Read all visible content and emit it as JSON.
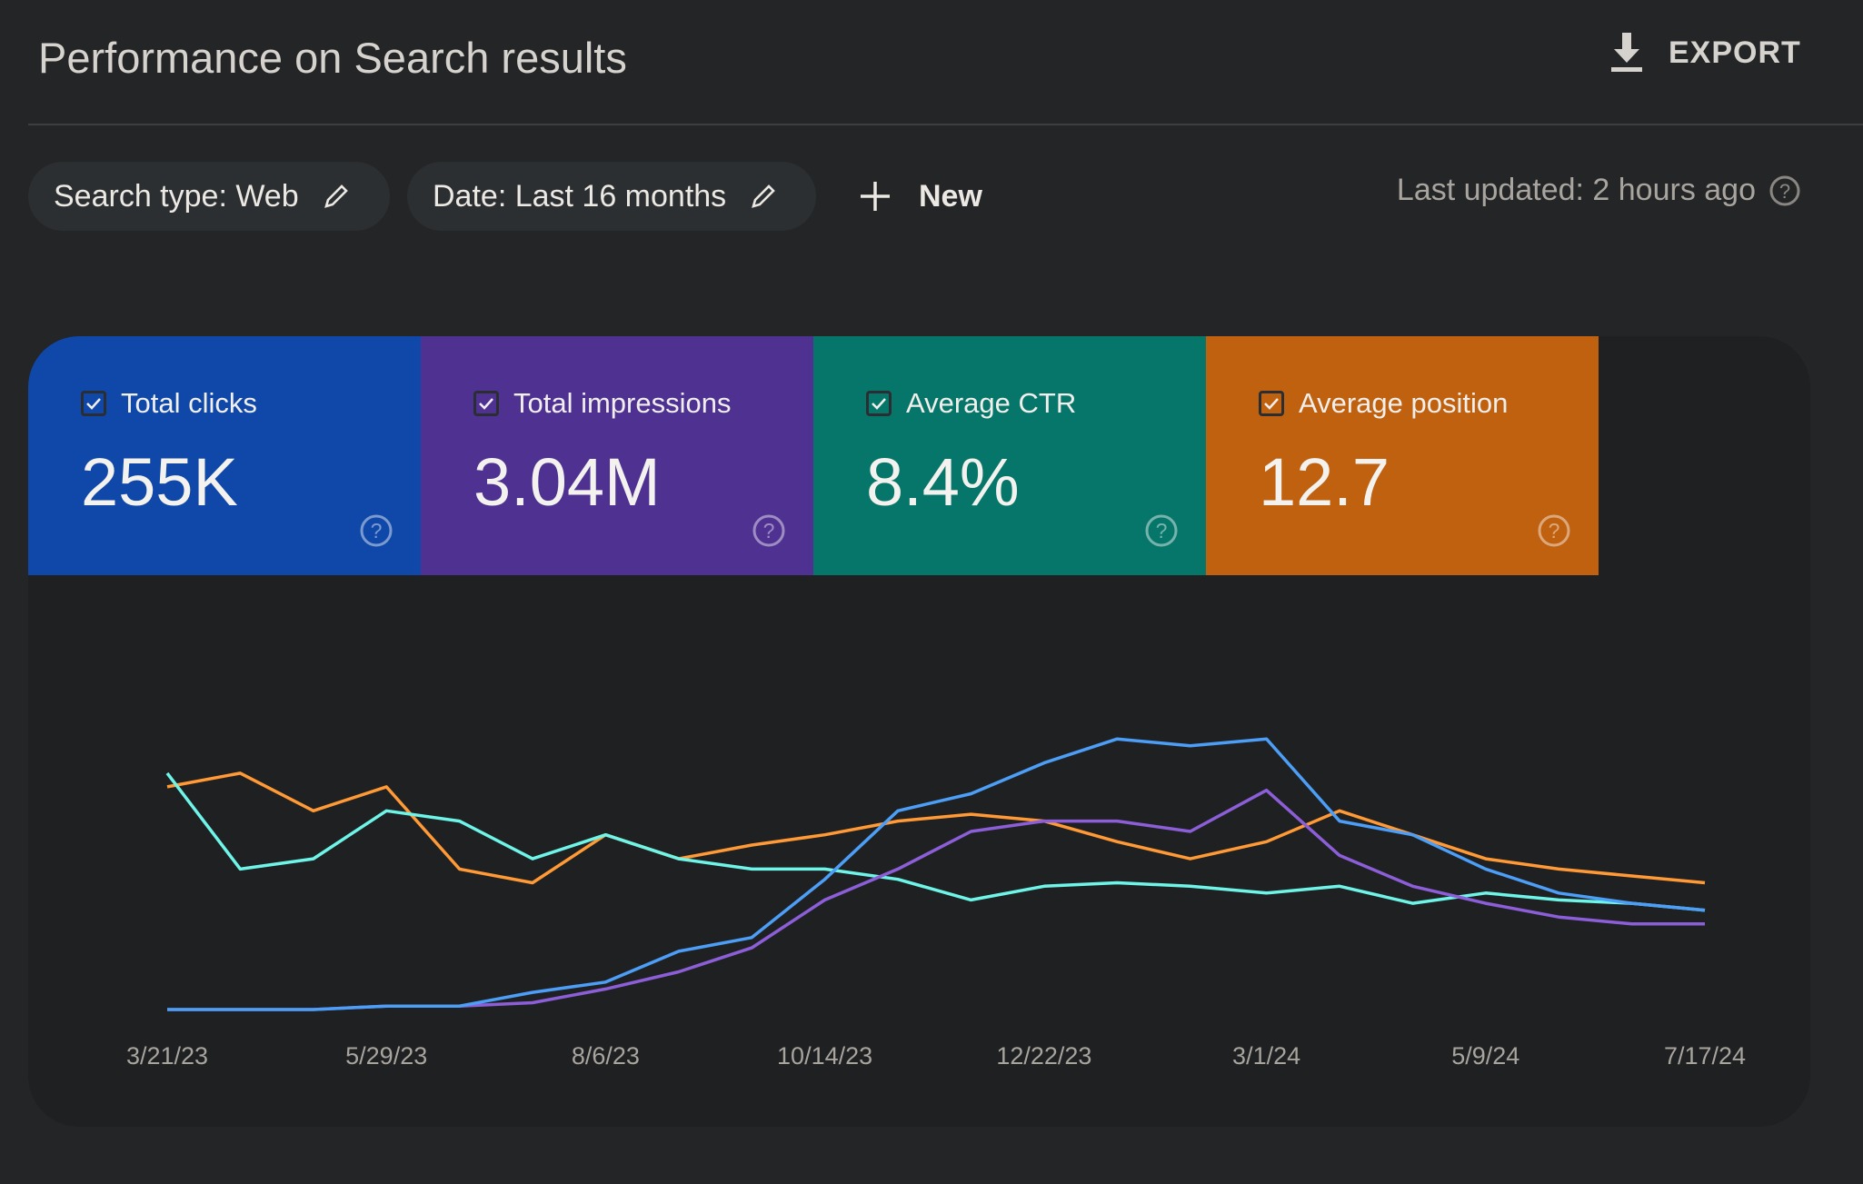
{
  "header": {
    "title": "Performance on Search results",
    "export_label": "EXPORT",
    "export_icon": "download-icon"
  },
  "filters": {
    "chips": [
      {
        "label": "Search type: Web",
        "icon": "pencil-icon"
      },
      {
        "label": "Date: Last 16 months",
        "icon": "pencil-icon"
      }
    ],
    "new_label": "New",
    "new_icon": "plus-icon",
    "last_updated": "Last updated: 2 hours ago",
    "help_icon": "help-circle-icon"
  },
  "metrics": [
    {
      "label": "Total clicks",
      "value": "255K",
      "checked": true,
      "color": "#0f48a8",
      "line_color": "#4c9ef6"
    },
    {
      "label": "Total impressions",
      "value": "3.04M",
      "checked": true,
      "color": "#4f3192",
      "line_color": "#8c5fd8"
    },
    {
      "label": "Average CTR",
      "value": "8.4%",
      "checked": true,
      "color": "#06766a",
      "line_color": "#6ff5e8"
    },
    {
      "label": "Average position",
      "value": "12.7",
      "checked": true,
      "color": "#c0610f",
      "line_color": "#ff9a36"
    }
  ],
  "chart_data": {
    "type": "line",
    "title": "",
    "xlabel": "",
    "ylabel": "",
    "grid": false,
    "y_scale": "relative (each metric on its own hidden axis, 0-100)",
    "x_ticks": [
      "3/21/23",
      "5/29/23",
      "8/6/23",
      "10/14/23",
      "12/22/23",
      "3/1/24",
      "5/9/24",
      "7/17/24"
    ],
    "x": [
      "2023-03-21",
      "2023-04-13",
      "2023-05-06",
      "2023-05-29",
      "2023-06-21",
      "2023-07-14",
      "2023-08-06",
      "2023-08-29",
      "2023-09-21",
      "2023-10-14",
      "2023-11-06",
      "2023-11-29",
      "2023-12-22",
      "2024-01-14",
      "2024-02-06",
      "2024-03-01",
      "2024-03-24",
      "2024-04-16",
      "2024-05-09",
      "2024-06-01",
      "2024-06-24",
      "2024-07-17"
    ],
    "series": [
      {
        "name": "Total clicks",
        "color": "#4c9ef6",
        "values": [
          0,
          0,
          0,
          1,
          1,
          5,
          8,
          17,
          21,
          38,
          58,
          63,
          72,
          79,
          77,
          79,
          55,
          51,
          41,
          34,
          31,
          29
        ]
      },
      {
        "name": "Total impressions",
        "color": "#8c5fd8",
        "values": [
          0,
          0,
          0,
          1,
          1,
          2,
          6,
          11,
          18,
          32,
          41,
          52,
          55,
          55,
          52,
          64,
          45,
          36,
          31,
          27,
          25,
          25
        ]
      },
      {
        "name": "Average CTR",
        "color": "#6ff5e8",
        "values": [
          69,
          41,
          44,
          58,
          55,
          44,
          51,
          44,
          41,
          41,
          38,
          32,
          36,
          37,
          36,
          34,
          36,
          31,
          34,
          32,
          31,
          29
        ]
      },
      {
        "name": "Average position",
        "color": "#ff9a36",
        "values": [
          65,
          69,
          58,
          65,
          41,
          37,
          51,
          44,
          48,
          51,
          55,
          57,
          55,
          49,
          44,
          49,
          58,
          51,
          44,
          41,
          39,
          37
        ]
      }
    ]
  }
}
